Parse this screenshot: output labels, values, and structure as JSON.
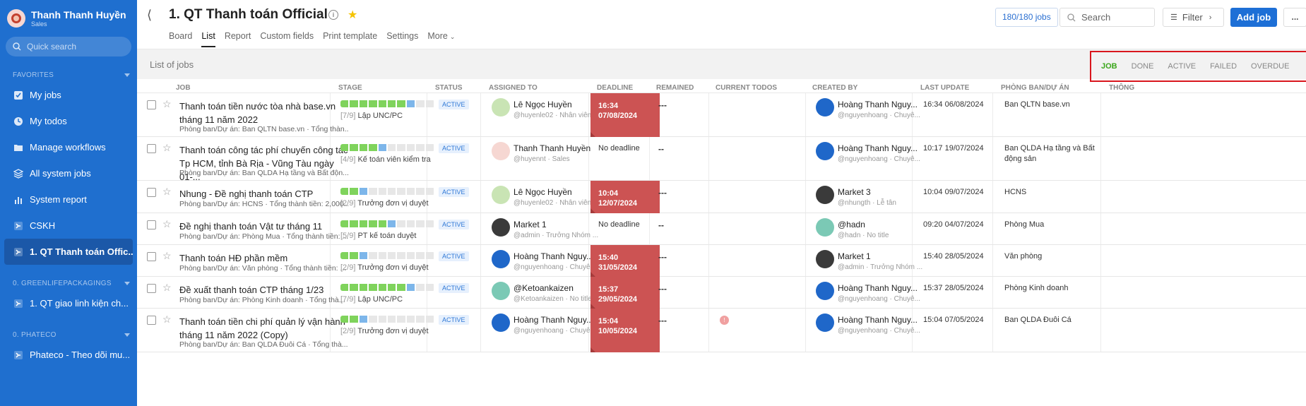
{
  "sidebar": {
    "user": {
      "name": "Thanh Thanh Huyền",
      "role": "Sales"
    },
    "quick_search": "Quick search",
    "favorites_label": "FAVORITES",
    "favorites": [
      {
        "label": "My jobs",
        "icon": "checkbox-icon"
      },
      {
        "label": "My todos",
        "icon": "clock-icon"
      },
      {
        "label": "Manage workflows",
        "icon": "folder-icon"
      },
      {
        "label": "All system jobs",
        "icon": "layers-icon"
      },
      {
        "label": "System report",
        "icon": "chart-icon"
      },
      {
        "label": "CSKH",
        "icon": "workflow-icon"
      },
      {
        "label": "1. QT Thanh toán Offic...",
        "icon": "workflow-icon"
      }
    ],
    "group1_label": "0. GREENLIFEPACKAGINGS",
    "group1": [
      {
        "label": "1. QT giao linh kiện ch..."
      }
    ],
    "group2_label": "0. PHATECO",
    "group2": [
      {
        "label": "Phateco - Theo dõi mu..."
      }
    ]
  },
  "header": {
    "title": "1. QT Thanh toán Official",
    "tabs": [
      "Board",
      "List",
      "Report",
      "Custom fields",
      "Print template",
      "Settings",
      "More"
    ],
    "job_count": "180/180 jobs",
    "search_placeholder": "Search",
    "filter_label": "Filter",
    "add_job_label": "Add job",
    "more_label": "..."
  },
  "listbar": {
    "label": "List of jobs",
    "filters": [
      "JOB",
      "DONE",
      "ACTIVE",
      "FAILED",
      "OVERDUE"
    ]
  },
  "columns": [
    "JOB",
    "STAGE",
    "STATUS",
    "ASSIGNED TO",
    "DEADLINE",
    "REMAINED",
    "CURRENT TODOS",
    "CREATED BY",
    "LAST UPDATE",
    "PHÒNG BAN/DỰ ÁN",
    "THÔNG"
  ],
  "rows": [
    {
      "title": "Thanh toán tiền nước tòa nhà base.vn tháng 11 năm 2022",
      "sub": "Phòng ban/Dự án: Ban QLTN base.vn · Tổng thàn...",
      "progress": [
        1,
        1,
        1,
        1,
        1,
        1,
        1,
        2,
        0,
        0
      ],
      "stage_num": "[7/9]",
      "stage": "Lập UNC/PC",
      "status": "ACTIVE",
      "assignee": "Lê Ngọc Huyền",
      "assignee_handle": "@huyenle02 · Nhân viên...",
      "deadline_time": "16:34",
      "deadline_date": "07/08/2024",
      "deadline_text": "",
      "remained": "---",
      "todo": "",
      "creator": "Hoàng Thanh Nguy...",
      "creator_handle": "@nguyenhoang · Chuyê...",
      "last_update": "16:34 06/08/2024",
      "dept": "Ban QLTN base.vn"
    },
    {
      "title": "Thanh toán công tác phí chuyến công tác Tp HCM, tỉnh Bà Rịa - Vũng Tàu ngày 01-...",
      "sub": "Phòng ban/Dự án: Ban QLDA Hạ tầng và Bất độn...",
      "progress": [
        1,
        1,
        1,
        1,
        2,
        0,
        0,
        0,
        0,
        0
      ],
      "stage_num": "[4/9]",
      "stage": "Kế toán viên kiểm tra",
      "status": "ACTIVE",
      "assignee": "Thanh Thanh Huyền",
      "assignee_handle": "@huyennt · Sales",
      "deadline_time": "",
      "deadline_date": "",
      "deadline_text": "No deadline",
      "remained": "--",
      "todo": "",
      "creator": "Hoàng Thanh Nguy...",
      "creator_handle": "@nguyenhoang · Chuyê...",
      "last_update": "10:17 19/07/2024",
      "dept": "Ban QLDA Hạ tầng và Bất động sản"
    },
    {
      "title": "Nhung - Đề nghị thanh toán CTP",
      "sub": "Phòng ban/Dự án: HCNS · Tổng thành tiền: 2,000...",
      "progress": [
        1,
        1,
        2,
        0,
        0,
        0,
        0,
        0,
        0,
        0
      ],
      "stage_num": "[2/9]",
      "stage": "Trưởng đơn vị duyệt",
      "status": "ACTIVE",
      "assignee": "Lê Ngọc Huyền",
      "assignee_handle": "@huyenle02 · Nhân viên...",
      "deadline_time": "10:04",
      "deadline_date": "12/07/2024",
      "deadline_text": "",
      "remained": "---",
      "todo": "",
      "creator": "Market 3",
      "creator_handle": "@nhungth · Lễ tân",
      "last_update": "10:04 09/07/2024",
      "dept": "HCNS"
    },
    {
      "title": "Đề nghị thanh toán Vật tư tháng 11",
      "sub": "Phòng ban/Dự án: Phòng Mua · Tổng thành tiền: ...",
      "progress": [
        1,
        1,
        1,
        1,
        1,
        2,
        0,
        0,
        0,
        0
      ],
      "stage_num": "[5/9]",
      "stage": "PT kế toán duyệt",
      "status": "ACTIVE",
      "assignee": "Market 1",
      "assignee_handle": "@admin · Trưởng Nhóm ...",
      "deadline_time": "",
      "deadline_date": "",
      "deadline_text": "No deadline",
      "remained": "--",
      "todo": "",
      "creator": "@hadn",
      "creator_handle": "@hadn · No title",
      "last_update": "09:20 04/07/2024",
      "dept": "Phòng Mua"
    },
    {
      "title": "Thanh toán HĐ phần mềm",
      "sub": "Phòng ban/Dự án: Văn phòng · Tổng thành tiền: ...",
      "progress": [
        1,
        1,
        2,
        0,
        0,
        0,
        0,
        0,
        0,
        0
      ],
      "stage_num": "[2/9]",
      "stage": "Trưởng đơn vị duyệt",
      "status": "ACTIVE",
      "assignee": "Hoàng Thanh Nguy...",
      "assignee_handle": "@nguyenhoang · Chuyê...",
      "deadline_time": "15:40",
      "deadline_date": "31/05/2024",
      "deadline_text": "",
      "remained": "---",
      "todo": "",
      "creator": "Market 1",
      "creator_handle": "@admin · Trưởng Nhóm ...",
      "last_update": "15:40 28/05/2024",
      "dept": "Văn phòng"
    },
    {
      "title": "Đề xuất thanh toán CTP tháng 1/23",
      "sub": "Phòng ban/Dự án: Phòng Kinh doanh · Tổng thà...",
      "progress": [
        1,
        1,
        1,
        1,
        1,
        1,
        1,
        2,
        0,
        0
      ],
      "stage_num": "[7/9]",
      "stage": "Lập UNC/PC",
      "status": "ACTIVE",
      "assignee": "@Ketoankaizen",
      "assignee_handle": "@Ketoankaizen · No title",
      "deadline_time": "15:37",
      "deadline_date": "29/05/2024",
      "deadline_text": "",
      "remained": "---",
      "todo": "",
      "creator": "Hoàng Thanh Nguy...",
      "creator_handle": "@nguyenhoang · Chuyê...",
      "last_update": "15:37 28/05/2024",
      "dept": "Phòng Kinh doanh"
    },
    {
      "title": "Thanh toán tiền chi phí quản lý vận hành tháng 11 năm 2022 (Copy)",
      "sub": "Phòng ban/Dự án: Ban QLDA Đuôi Cá · Tổng thà...",
      "progress": [
        1,
        1,
        2,
        0,
        0,
        0,
        0,
        0,
        0,
        0
      ],
      "stage_num": "[2/9]",
      "stage": "Trưởng đơn vị duyệt",
      "status": "ACTIVE",
      "assignee": "Hoàng Thanh Nguy...",
      "assignee_handle": "@nguyenhoang · Chuyê...",
      "deadline_time": "15:04",
      "deadline_date": "10/05/2024",
      "deadline_text": "",
      "remained": "---",
      "todo": "!",
      "creator": "Hoàng Thanh Nguy...",
      "creator_handle": "@nguyenhoang · Chuyê...",
      "last_update": "15:04 07/05/2024",
      "dept": "Ban QLDA Đuôi Cá"
    }
  ],
  "avatars": {
    "rows": [
      [
        "green",
        "blue"
      ],
      [
        "pink",
        "blue"
      ],
      [
        "green",
        "dark"
      ],
      [
        "dark",
        "teal"
      ],
      [
        "blue",
        "dark"
      ],
      [
        "teal",
        "blue"
      ],
      [
        "blue",
        "blue"
      ]
    ]
  }
}
